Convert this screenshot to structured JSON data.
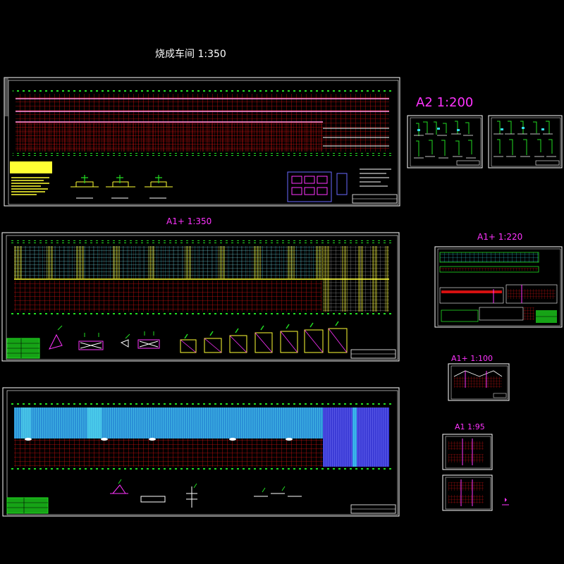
{
  "drawing": {
    "main_title": "烧成车间 1:350",
    "scale_labels": {
      "a2": "A2   1:200",
      "a1plus_350": "A1+   1:350",
      "a1plus_220": "A1+   1:220",
      "a1plus_100": "A1+   1:100",
      "a1_95": "A1   1:95"
    },
    "colors": {
      "background": "#000000",
      "frame": "#ffffff",
      "grid_red": "#d41010",
      "grid_green": "#22dd22",
      "member_yellow": "#ffff33",
      "roof_cyan": "#33ddee",
      "roof_blue": "#6a6aff",
      "label_magenta": "#ff33ff"
    }
  }
}
